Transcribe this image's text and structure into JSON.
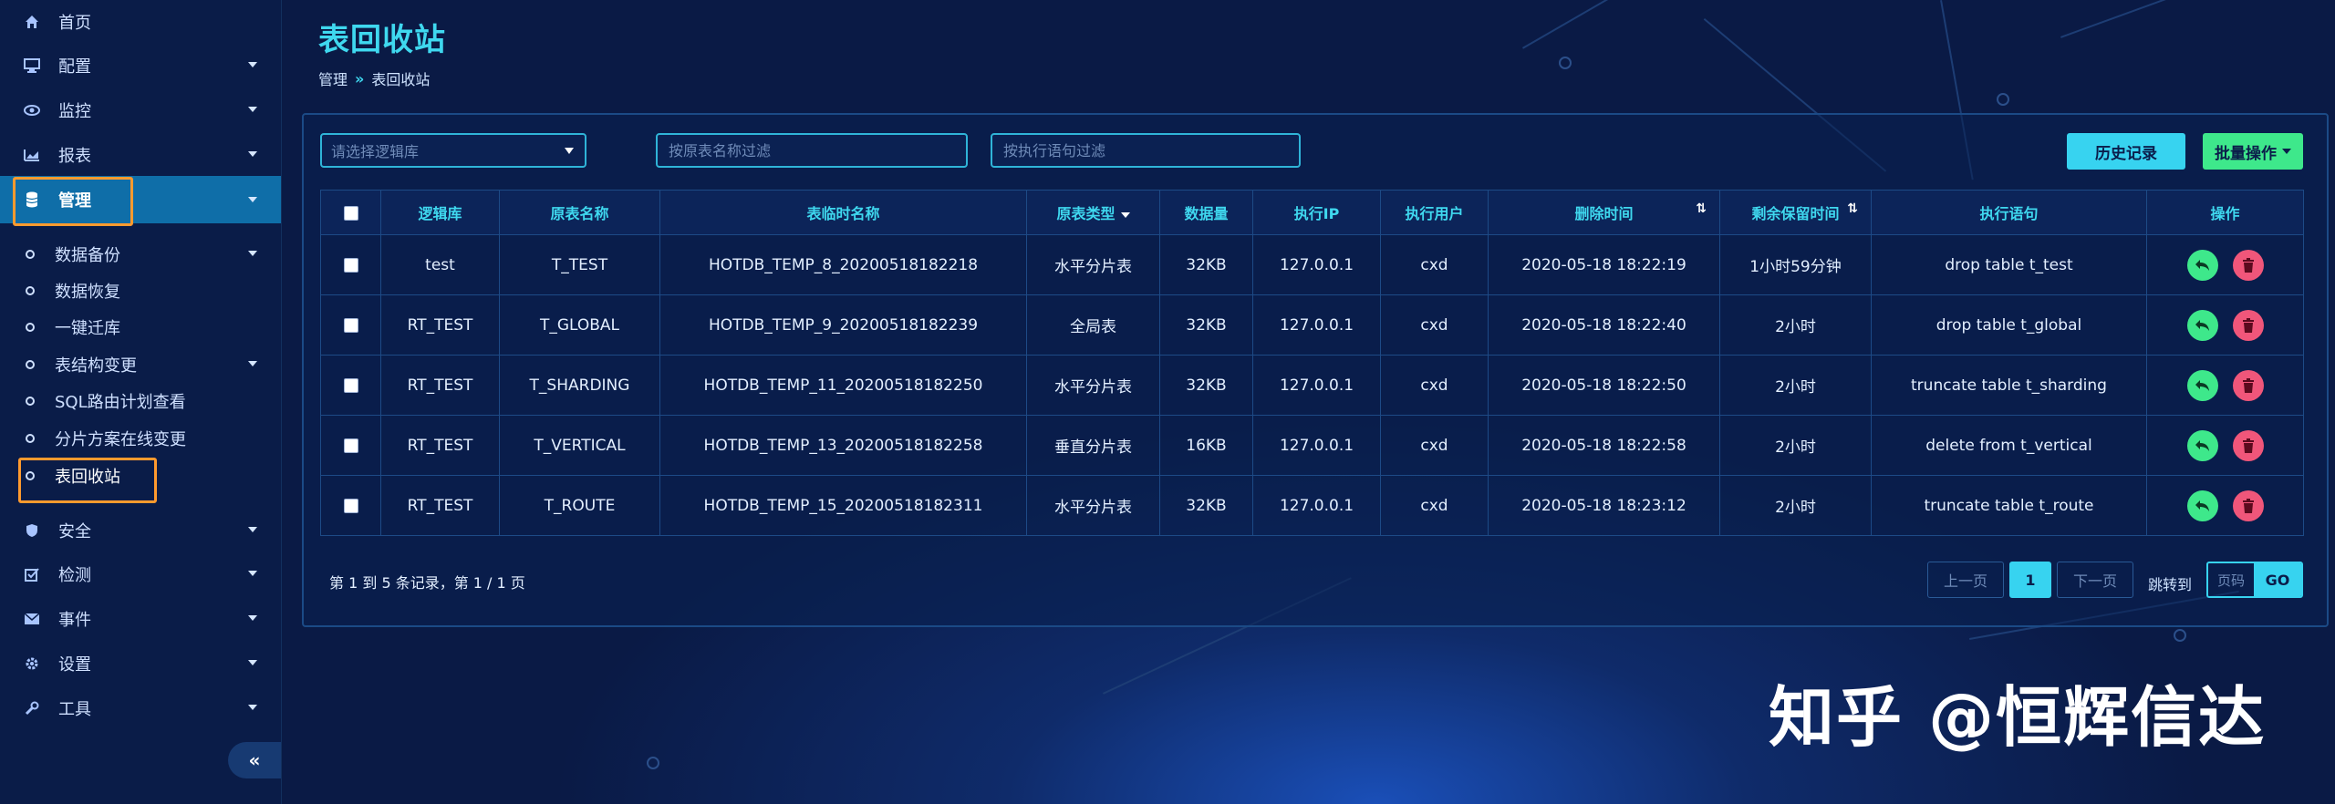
{
  "sidebar": {
    "items": [
      {
        "label": "首页",
        "icon": "home-icon"
      },
      {
        "label": "配置",
        "icon": "monitor-icon"
      },
      {
        "label": "监控",
        "icon": "eye-icon"
      },
      {
        "label": "报表",
        "icon": "chart-icon"
      },
      {
        "label": "管理",
        "icon": "database-icon"
      }
    ],
    "sub_items": [
      {
        "label": "数据备份"
      },
      {
        "label": "数据恢复"
      },
      {
        "label": "一键迁库"
      },
      {
        "label": "表结构变更"
      },
      {
        "label": "SQL路由计划查看"
      },
      {
        "label": "分片方案在线变更"
      },
      {
        "label": "表回收站"
      }
    ],
    "bottom_items": [
      {
        "label": "安全",
        "icon": "shield-icon"
      },
      {
        "label": "检测",
        "icon": "checkbox-icon"
      },
      {
        "label": "事件",
        "icon": "envelope-icon"
      },
      {
        "label": "设置",
        "icon": "gear-icon"
      },
      {
        "label": "工具",
        "icon": "wrench-icon"
      }
    ],
    "collapse_label": "«"
  },
  "header": {
    "title": "表回收站",
    "breadcrumb": [
      "管理",
      "表回收站"
    ],
    "breadcrumb_sep": "»"
  },
  "filters": {
    "logic_db_placeholder": "请选择逻辑库",
    "table_name_placeholder": "按原表名称过滤",
    "statement_placeholder": "按执行语句过滤"
  },
  "toolbar": {
    "history_label": "历史记录",
    "batch_label": "批量操作"
  },
  "table": {
    "columns": [
      "逻辑库",
      "原表名称",
      "表临时名称",
      "原表类型",
      "数据量",
      "执行IP",
      "执行用户",
      "删除时间",
      "剩余保留时间",
      "执行语句",
      "操作"
    ],
    "rows": [
      [
        "test",
        "T_TEST",
        "HOTDB_TEMP_8_20200518182218",
        "水平分片表",
        "32KB",
        "127.0.0.1",
        "cxd",
        "2020-05-18 18:22:19",
        "1小时59分钟",
        "drop table t_test"
      ],
      [
        "RT_TEST",
        "T_GLOBAL",
        "HOTDB_TEMP_9_20200518182239",
        "全局表",
        "32KB",
        "127.0.0.1",
        "cxd",
        "2020-05-18 18:22:40",
        "2小时",
        "drop table t_global"
      ],
      [
        "RT_TEST",
        "T_SHARDING",
        "HOTDB_TEMP_11_20200518182250",
        "水平分片表",
        "32KB",
        "127.0.0.1",
        "cxd",
        "2020-05-18 18:22:50",
        "2小时",
        "truncate table t_sharding"
      ],
      [
        "RT_TEST",
        "T_VERTICAL",
        "HOTDB_TEMP_13_20200518182258",
        "垂直分片表",
        "16KB",
        "127.0.0.1",
        "cxd",
        "2020-05-18 18:22:58",
        "2小时",
        "delete from t_vertical"
      ],
      [
        "RT_TEST",
        "T_ROUTE",
        "HOTDB_TEMP_15_20200518182311",
        "水平分片表",
        "32KB",
        "127.0.0.1",
        "cxd",
        "2020-05-18 18:23:12",
        "2小时",
        "truncate table t_route"
      ]
    ]
  },
  "pagination": {
    "info": "第 1 到 5 条记录，第 1 / 1 页",
    "prev_label": "上一页",
    "current_page": "1",
    "next_label": "下一页",
    "jump_label": "跳转到",
    "page_placeholder": "页码",
    "go_label": "GO"
  },
  "watermark": "知乎 @恒辉信达",
  "colors": {
    "accent": "#3fd8ef",
    "restore": "#3ee88b",
    "delete": "#f0567a",
    "highlight": "#ff9a2e"
  }
}
